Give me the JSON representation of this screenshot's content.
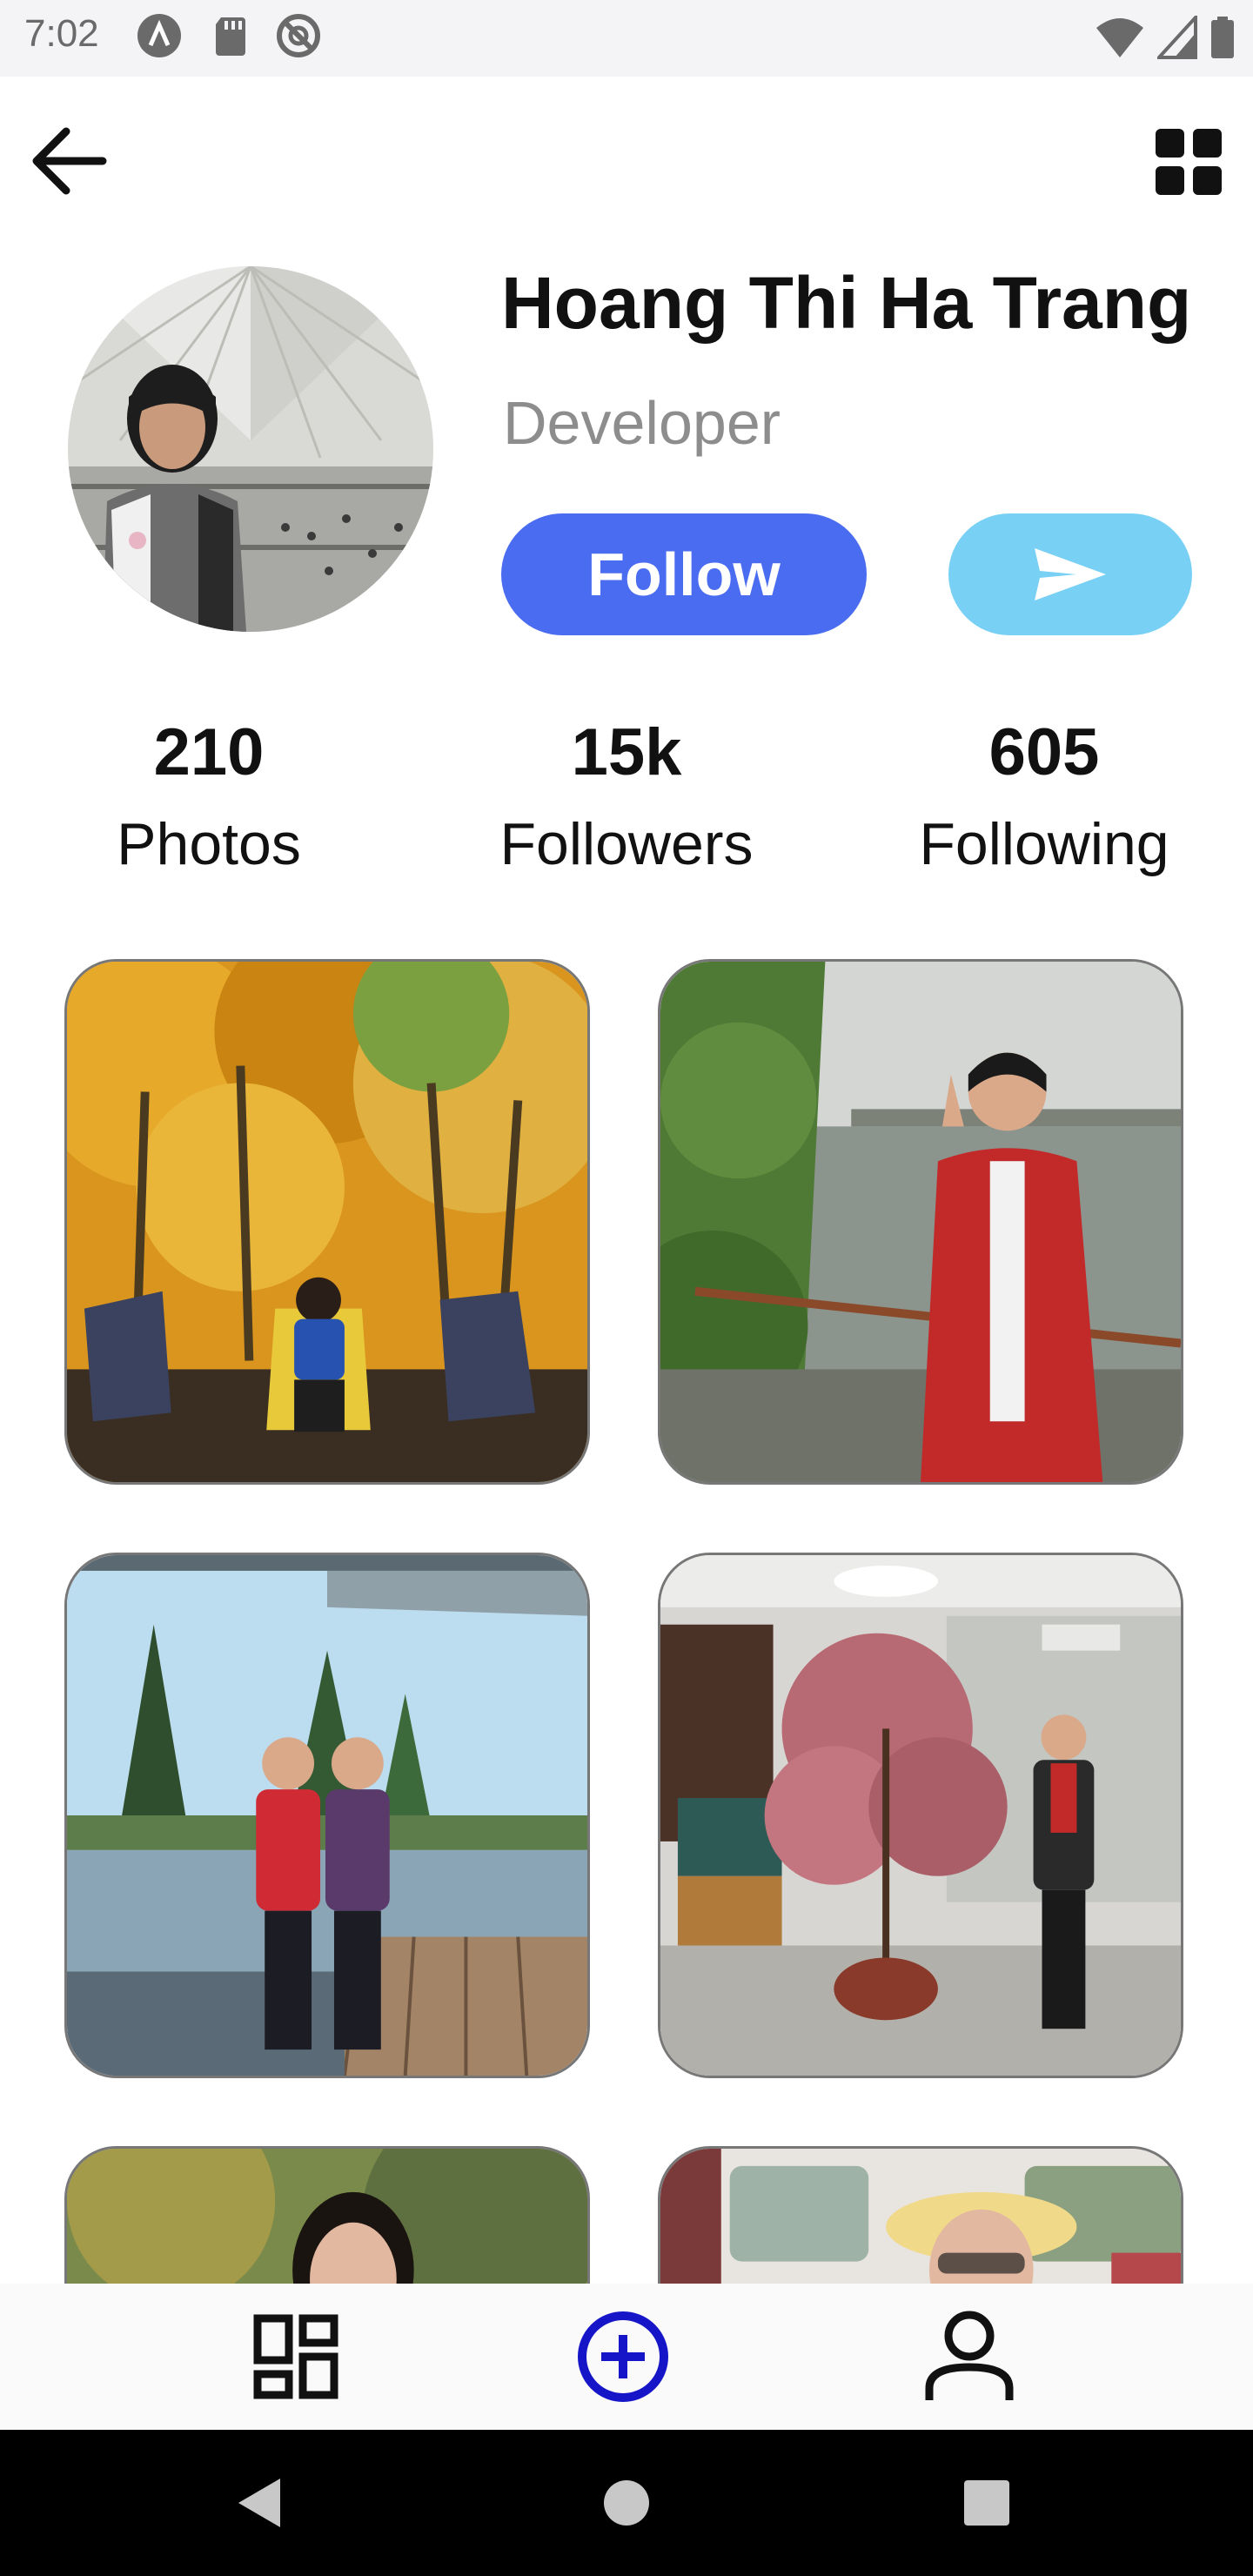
{
  "status_bar": {
    "time": "7:02",
    "left_icons": [
      "app-a-icon",
      "sd-card-icon",
      "no-disturb-icon"
    ],
    "right_icons": [
      "wifi-icon",
      "cellular-signal-icon",
      "battery-icon"
    ]
  },
  "header": {
    "back_icon": "arrow-left-icon",
    "menu_icon": "grid-apps-icon"
  },
  "profile": {
    "name": "Hoang Thi Ha Trang",
    "role": "Developer",
    "follow_label": "Follow",
    "send_icon": "send-icon",
    "colors": {
      "follow_bg": "#4a6cf0",
      "send_bg": "#79d0f5"
    }
  },
  "stats": [
    {
      "value": "210",
      "label": "Photos"
    },
    {
      "value": "15k",
      "label": "Followers"
    },
    {
      "value": "605",
      "label": "Following"
    }
  ],
  "photos": [
    {
      "scene": "autumn-chairs"
    },
    {
      "scene": "lake-red-coat"
    },
    {
      "scene": "glass-terrace"
    },
    {
      "scene": "office-blossom"
    },
    {
      "scene": "park-portrait"
    },
    {
      "scene": "bus-hat"
    }
  ],
  "bottom_nav": [
    {
      "icon": "dashboard-icon",
      "active": false
    },
    {
      "icon": "add-circle-icon",
      "active": true
    },
    {
      "icon": "person-icon",
      "active": false
    }
  ],
  "system_nav": [
    "back-triangle-icon",
    "home-circle-icon",
    "recents-square-icon"
  ]
}
